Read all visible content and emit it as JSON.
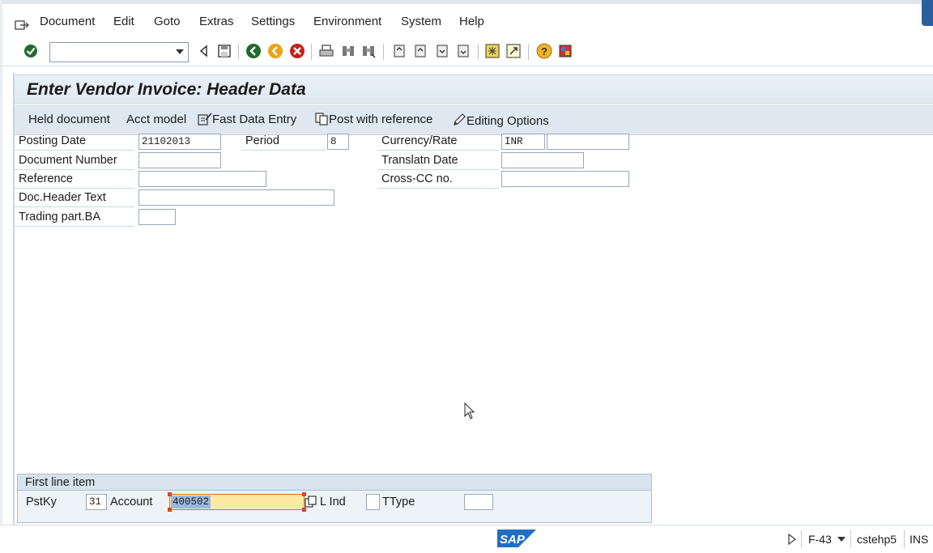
{
  "menu": {
    "items": [
      "Document",
      "Edit",
      "Goto",
      "Extras",
      "Settings",
      "Environment",
      "System",
      "Help"
    ]
  },
  "toolbar": {
    "command_field_value": ""
  },
  "screen": {
    "title": "Enter Vendor Invoice: Header Data"
  },
  "app_toolbar": {
    "held_document": "Held document",
    "acct_model": "Acct model",
    "fast_data_entry": "Fast Data Entry",
    "post_with_reference": "Post with reference",
    "editing_options": "Editing Options"
  },
  "header": {
    "posting_date_label": "Posting Date",
    "posting_date_value": "21102013",
    "period_label": "Period",
    "period_value": "8",
    "currency_rate_label": "Currency/Rate",
    "currency_value": "INR",
    "rate_value": "",
    "document_number_label": "Document Number",
    "document_number_value": "",
    "translatn_date_label": "Translatn Date",
    "translatn_date_value": "",
    "reference_label": "Reference",
    "reference_value": "",
    "cross_cc_label": "Cross-CC no.",
    "cross_cc_value": "",
    "doc_header_text_label": "Doc.Header Text",
    "doc_header_text_value": "",
    "trading_part_label": "Trading part.BA",
    "trading_part_value": ""
  },
  "first_line_item": {
    "title": "First line item",
    "pstky_label": "PstKy",
    "pstky_value": "31",
    "account_label": "Account",
    "account_value": "400502",
    "sgl_ind_label": "L Ind",
    "sgl_ind_value": "",
    "ttype_label": "TType",
    "ttype_value": ""
  },
  "status": {
    "transaction": "F-43",
    "server": "cstehp5",
    "mode": "INS"
  },
  "colors": {
    "title_bg": "#e4ecf4",
    "highlight_field": "#fde9a2",
    "selection": "#9db8dc"
  }
}
